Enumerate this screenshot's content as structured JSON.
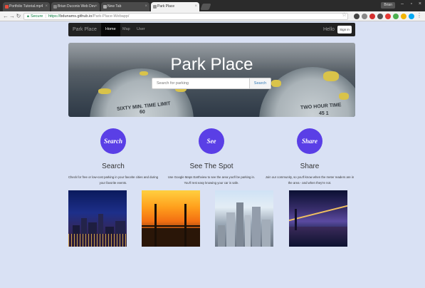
{
  "browser": {
    "tabs": [
      {
        "label": "Portfolio Tutorial.mp4"
      },
      {
        "label": "Brian Duconis Web Dev"
      },
      {
        "label": "New Tab"
      },
      {
        "label": "Park Place"
      }
    ],
    "user": "Brian",
    "url": {
      "secure_label": "Secure",
      "scheme": "https://",
      "host": "bdunams.github.io",
      "path": "/Park-Place-Webapp/"
    }
  },
  "navbar": {
    "brand": "Park Place",
    "links": [
      {
        "label": "Home",
        "active": true
      },
      {
        "label": "Map",
        "active": false
      },
      {
        "label": "User",
        "active": false
      }
    ],
    "hello": "Hello",
    "signin": "Sign in"
  },
  "hero": {
    "title": "Park Place",
    "search_placeholder": "Search for parking",
    "search_button": "Search",
    "meter_left_text": "SIXTY MIN. TIME LIMIT",
    "meter_right_text": "TWO HOUR TIME",
    "meter_left_digit": "60",
    "meter_right_digits": "45  1"
  },
  "features": [
    {
      "icon_label": "Search",
      "title": "Search",
      "text": "Check for free or low-cost parking in your favorite cities and during your favorite events."
    },
    {
      "icon_label": "See",
      "title": "See The Spot",
      "text": "Use Google Maps Earthview to see the area you'll be parking in. You'll rest easy knowing your car is safe."
    },
    {
      "icon_label": "Share",
      "title": "Share",
      "text": "Join our community, so you'll know when the meter readers are in the area - and when they're not."
    }
  ],
  "colors": {
    "accent_circle": "#5a3fe6",
    "page_background": "#d9e1f4",
    "navbar": "#222222"
  }
}
